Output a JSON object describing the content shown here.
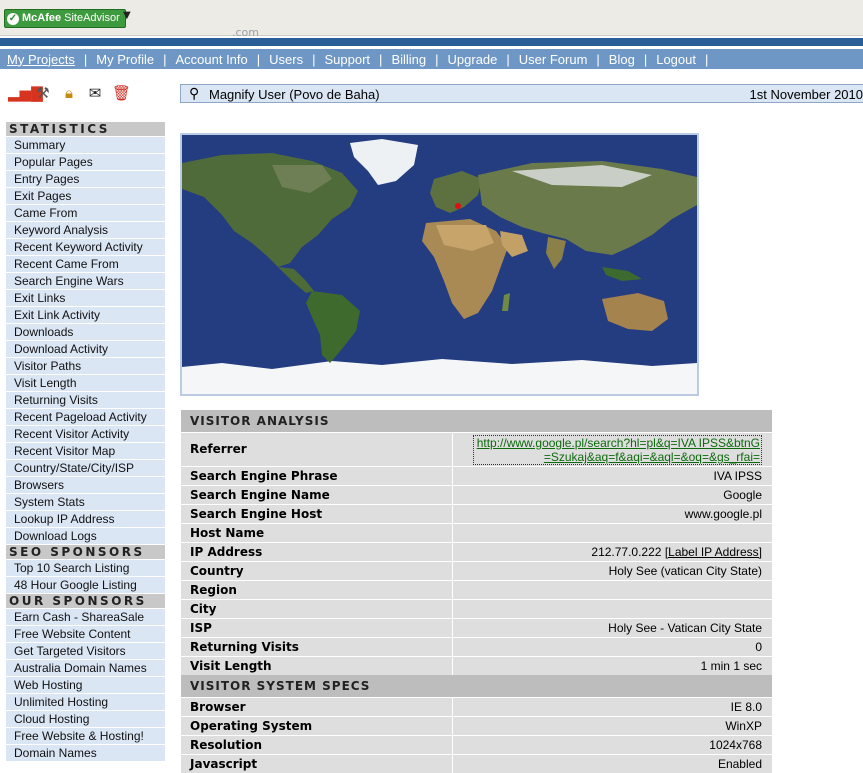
{
  "toolbar": {
    "mcafee_label": "McAfee",
    "siteadvisor_label": "SiteAdvisor",
    "stub_text": ".com"
  },
  "nav": {
    "items": [
      "My Projects",
      "My Profile",
      "Account Info",
      "Users",
      "Support",
      "Billing",
      "Upgrade",
      "User Forum",
      "Blog",
      "Logout"
    ],
    "active": "My Projects"
  },
  "icons": [
    "bar-chart-icon",
    "tools-icon",
    "lock-icon",
    "mail-icon",
    "trash-icon"
  ],
  "header": {
    "title": "Magnify User (Povo de Baha)",
    "date": "1st November 2010"
  },
  "sidebar": {
    "statistics_title": "STATISTICS",
    "statistics": [
      "Summary",
      "Popular Pages",
      "Entry Pages",
      "Exit Pages",
      "Came From",
      "Keyword Analysis",
      "Recent Keyword Activity",
      "Recent Came From",
      "Search Engine Wars",
      "Exit Links",
      "Exit Link Activity",
      "Downloads",
      "Download Activity",
      "Visitor Paths",
      "Visit Length",
      "Returning Visits",
      "Recent Pageload Activity",
      "Recent Visitor Activity",
      "Recent Visitor Map",
      "Country/State/City/ISP",
      "Browsers",
      "System Stats",
      "Lookup IP Address",
      "Download Logs"
    ],
    "seo_title": "SEO SPONSORS",
    "seo": [
      "Top 10 Search Listing",
      "48 Hour Google Listing"
    ],
    "our_title": "OUR SPONSORS",
    "our": [
      "Earn Cash - ShareaSale",
      "Free Website Content",
      "Get Targeted Visitors",
      "Australia Domain Names",
      "Web Hosting",
      "Unlimited Hosting",
      "Cloud Hosting",
      "Free Website & Hosting!",
      "Domain Names"
    ]
  },
  "analysis": {
    "title": "VISITOR ANALYSIS",
    "referrer_label": "Referrer",
    "referrer_value": "http://www.google.pl/search?hl=pl&q=IVA IPSS&btnG=Szukaj&aq=f&aqi=&aql=&oq=&gs_rfai=",
    "rows": [
      {
        "label": "Search Engine Phrase",
        "value": "IVA IPSS"
      },
      {
        "label": "Search Engine Name",
        "value": "Google"
      },
      {
        "label": "Search Engine Host",
        "value": "www.google.pl"
      },
      {
        "label": "Host Name",
        "value": ""
      }
    ],
    "ip_label": "IP Address",
    "ip_value": "212.77.0.222",
    "ip_link": "[Label IP Address]",
    "rows2": [
      {
        "label": "Country",
        "value": "Holy See (vatican City State)"
      },
      {
        "label": "Region",
        "value": ""
      },
      {
        "label": "City",
        "value": ""
      },
      {
        "label": "ISP",
        "value": "Holy See - Vatican City State"
      },
      {
        "label": "Returning Visits",
        "value": "0"
      },
      {
        "label": "Visit Length",
        "value": "1 min 1 sec"
      }
    ]
  },
  "specs": {
    "title": "VISITOR SYSTEM SPECS",
    "rows": [
      {
        "label": "Browser",
        "value": "IE 8.0"
      },
      {
        "label": "Operating System",
        "value": "WinXP"
      },
      {
        "label": "Resolution",
        "value": "1024x768"
      },
      {
        "label": "Javascript",
        "value": "Enabled"
      }
    ]
  },
  "colors": {
    "nav_bar": "#6e97c5",
    "dark_bar": "#2a5e96",
    "sidebar_item": "#dbe6f5",
    "ocean": "#243c80",
    "visitor_marker": "#e01010"
  }
}
